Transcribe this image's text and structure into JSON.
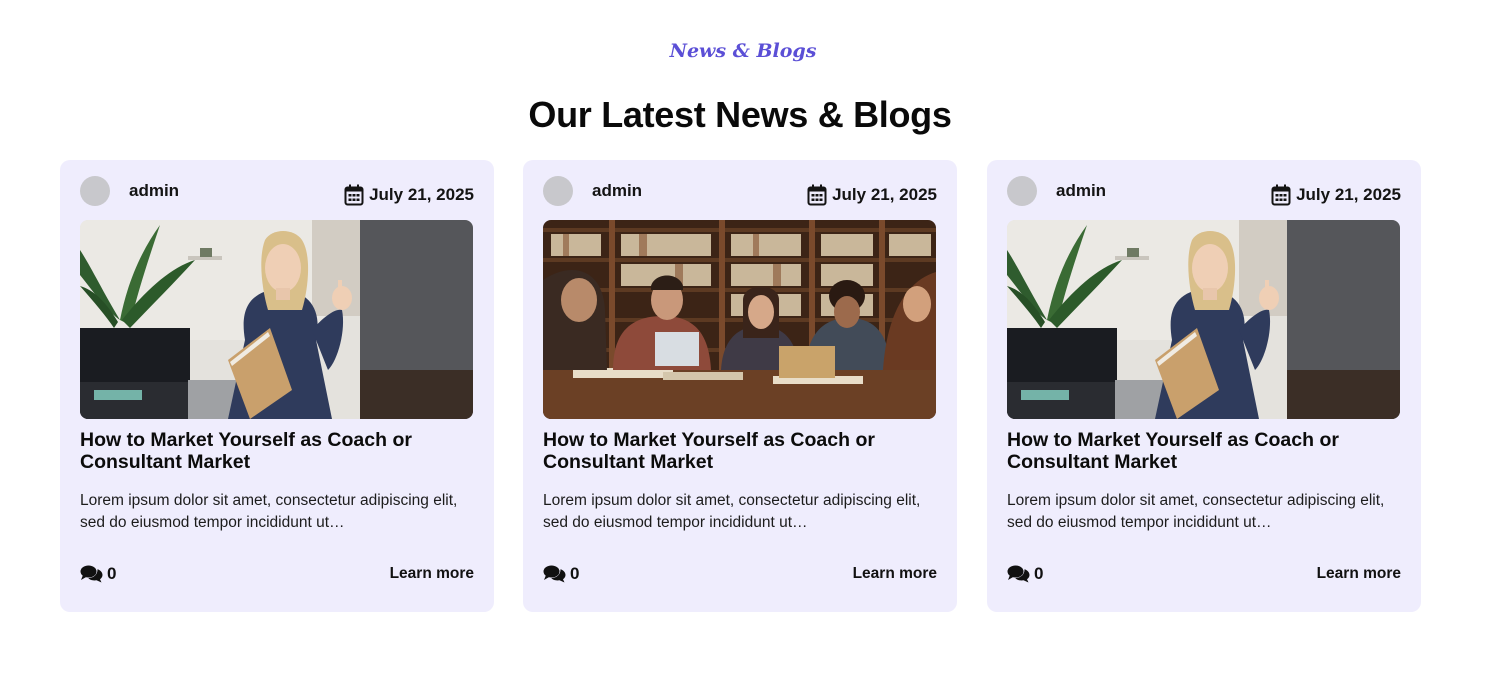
{
  "section": {
    "eyebrow": "News & Blogs",
    "heading": "Our Latest News & Blogs",
    "accent_color": "#5b4fd6",
    "card_background": "#efedfd"
  },
  "posts": [
    {
      "author": "admin",
      "date": "July 21, 2025",
      "image": "woman-with-notebook-photo",
      "title": "How to Market Yourself as Coach or Consultant Market",
      "excerpt": "Lorem ipsum dolor sit amet, consectetur adipiscing elit, sed do eiusmod tempor incididunt ut…",
      "comment_count": "0",
      "link_label": "Learn more"
    },
    {
      "author": "admin",
      "date": "July 21, 2025",
      "image": "students-in-library-photo",
      "title": "How to Market Yourself as Coach or Consultant Market",
      "excerpt": "Lorem ipsum dolor sit amet, consectetur adipiscing elit, sed do eiusmod tempor incididunt ut…",
      "comment_count": "0",
      "link_label": "Learn more"
    },
    {
      "author": "admin",
      "date": "July 21, 2025",
      "image": "woman-with-notebook-photo",
      "title": "How to Market Yourself as Coach or Consultant Market",
      "excerpt": "Lorem ipsum dolor sit amet, consectetur adipiscing elit, sed do eiusmod tempor incididunt ut…",
      "comment_count": "0",
      "link_label": "Learn more"
    }
  ]
}
